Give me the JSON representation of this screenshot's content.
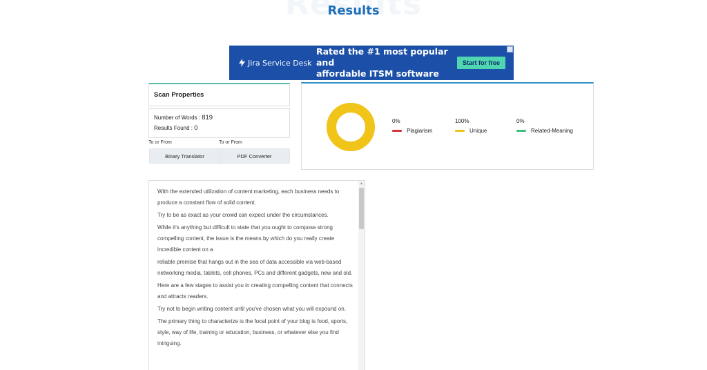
{
  "page": {
    "watermark": "Results",
    "title": "Results"
  },
  "ad": {
    "brand": "Jira Service Desk",
    "headline_line1": "Rated the #1 most popular and",
    "headline_line2": "affordable ITSM software",
    "cta": "Start for free",
    "brand_color": "#1b4fa8",
    "cta_color": "#4fd6b0"
  },
  "scan": {
    "heading": "Scan Properties",
    "words_label": "Number of Words : ",
    "words_value": "819",
    "results_label": "Results Found : ",
    "results_value": "0"
  },
  "tools": [
    {
      "label": "To or From",
      "button": "Binary Translator"
    },
    {
      "label": "To or From",
      "button": "PDF Converter"
    }
  ],
  "results": {
    "donut_color": "#f0c419",
    "unique_fraction": 1.0,
    "metrics": [
      {
        "pct": "0%",
        "name": "Plagiarism",
        "color": "#d9363e"
      },
      {
        "pct": "100%",
        "name": "Unique",
        "color": "#f0c419"
      },
      {
        "pct": "0%",
        "name": "Related-Meaning",
        "color": "#3fbf7f"
      }
    ]
  },
  "content": {
    "paragraphs": [
      "With the extended utilization of content marketing, each business needs to produce a constant flow of solid content.",
      "Try to be as exact as your crowd can expect under the circumstances.",
      "While it's anything but difficult to state that you ought to compose strong compelling content, the issue is the means by which do you really create incredible content on a",
      "reliable premise that hangs out in the sea of data accessible via web-based networking media, tablets, cell phones, PCs and different gadgets, new and old.",
      "Here are a few stages to assist you in creating compelling content that connects and attracts readers.",
      "Try not to begin writing content until you've chosen what you will expound on.",
      "The primary thing to characterize is the focal point of your blog is food, sports, style, way of life, training or education, business, or whatever else you find intriguing."
    ]
  }
}
